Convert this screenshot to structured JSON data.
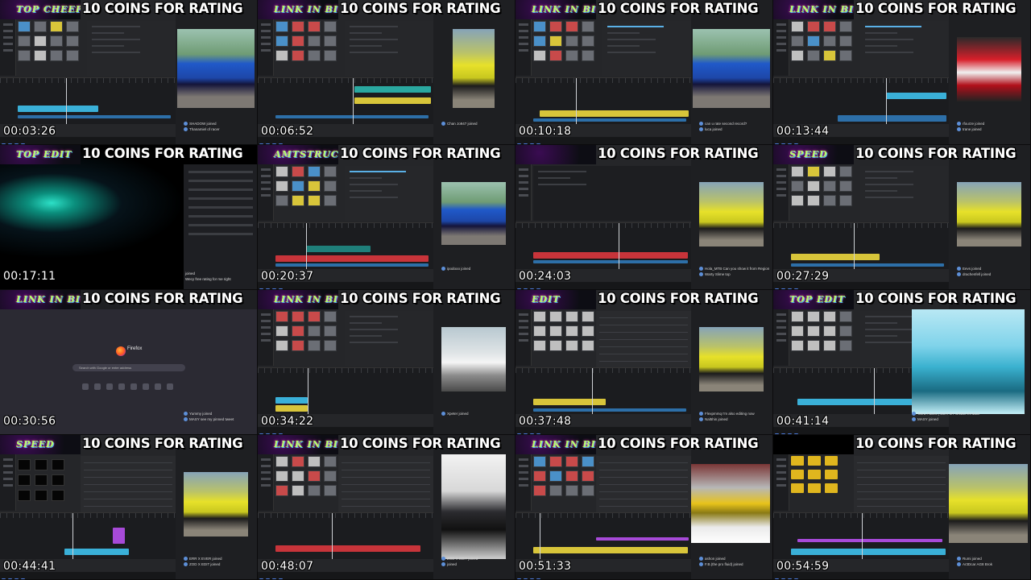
{
  "banner": "10 COINS FOR RATING",
  "tiles": [
    {
      "timestamp": "00:03:26",
      "logo": "TOP CHEEP",
      "chat": [
        "SHADOW joined",
        "Thanamiel of racer"
      ]
    },
    {
      "timestamp": "00:06:52",
      "logo": "LINK IN BIO",
      "chat": [
        "Chan Jo947 joined"
      ]
    },
    {
      "timestamp": "00:10:18",
      "logo": "LINK IN BIO",
      "chat": [
        "can u rate second record?",
        "luca joined"
      ]
    },
    {
      "timestamp": "00:13:44",
      "logo": "LINK IN BIO",
      "chat": [
        "rfourze joined",
        "trane joined"
      ]
    },
    {
      "timestamp": "00:17:11",
      "logo": "TOP EDIT",
      "chat": [
        "joined",
        "Wecy free rating for me right"
      ]
    },
    {
      "timestamp": "00:20:37",
      "logo": "AMTSTRUCK",
      "chat": [
        "ipodooo joined"
      ]
    },
    {
      "timestamp": "00:24:03",
      "logo": "",
      "chat": [
        "Hola_MTB Can you show it from Region",
        "Warty Slime top"
      ]
    },
    {
      "timestamp": "00:27:29",
      "logo": "SPEED",
      "chat": [
        "Eevs joined",
        "drachenfell joined"
      ]
    },
    {
      "timestamp": "00:30:56",
      "logo": "LINK IN BIO",
      "chat": [
        "Yummy joined",
        "MASY see my pinned tweet"
      ],
      "firefox": {
        "name": "Firefox",
        "search": "Search with Google or enter address"
      }
    },
    {
      "timestamp": "00:34:22",
      "logo": "LINK IN BIO",
      "chat": [
        "Xpeter joined"
      ]
    },
    {
      "timestamp": "00:37:48",
      "logo": "EDIT",
      "chat": [
        "Flexpmmq I'm also editing now",
        "Nal5hin joined"
      ]
    },
    {
      "timestamp": "00:41:14",
      "logo": "TOP EDIT",
      "chat": [
        "Tarra Pacific | EDIT BY UNBEARABLE",
        "MASY joined"
      ]
    },
    {
      "timestamp": "00:44:41",
      "logo": "SPEED",
      "chat": [
        "ERR X EVER joined",
        "ZOD X EDIT joined"
      ]
    },
    {
      "timestamp": "00:48:07",
      "logo": "LINK IN BIO",
      "chat": [
        "ZOD X EDIT joined",
        "joined"
      ]
    },
    {
      "timestamp": "00:51:33",
      "logo": "LINK IN BIO",
      "chat": [
        "ashon joined",
        "F.B.(the pro fluid) joined"
      ]
    },
    {
      "timestamp": "00:54:59",
      "logo": "",
      "chat": [
        "Rumi joined",
        "Ar3Dcar AG8 Brok"
      ]
    }
  ]
}
